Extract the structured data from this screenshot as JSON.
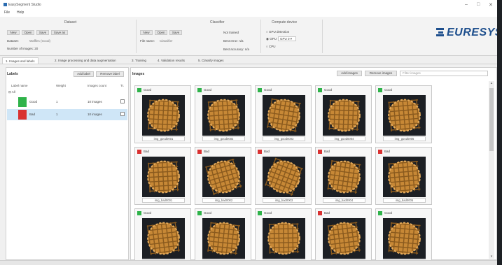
{
  "window": {
    "title": "EasySegment Studio",
    "controls": [
      "–",
      "□",
      "✕"
    ]
  },
  "menu": [
    "File",
    "Help"
  ],
  "ribbon": {
    "dataset": {
      "title": "Dataset",
      "buttons": [
        "New",
        "Open",
        "Save",
        "Save as"
      ],
      "project_label": "Dataset:",
      "project_value": "Waffles (Good)",
      "images_label": "Number of images: 20"
    },
    "classifier": {
      "title": "Classifier",
      "buttons": [
        "New",
        "Open",
        "Save"
      ],
      "name_label": "File name:",
      "name_value": "Classifier"
    },
    "stats": {
      "lines": [
        "Not trained",
        "Best error: n/a",
        "Best accuracy: n/a"
      ]
    },
    "compute": {
      "title": "Compute device",
      "auto_label": "GPU detection",
      "gpu_label": "GPU",
      "gpu_value": "GPU 0",
      "cpu_label": "CPU"
    }
  },
  "logo": {
    "text": "EURESYS",
    "color": "#1e4f8d",
    "icon": "euresys-logo-icon"
  },
  "tabs": [
    "1. Images and labels",
    "2. Image processing and data augmentation",
    "3. Training",
    "4. Validation results",
    "5. Classify images"
  ],
  "labels_panel": {
    "title": "Labels",
    "buttons": [
      "Add label",
      "Remove label"
    ],
    "columns": [
      "Label name",
      "Weight",
      "Images count",
      "Tr."
    ],
    "tree_root": "All",
    "rows": [
      {
        "name": "Good",
        "weight": "1",
        "images": "10 images",
        "color": "#2fb34a",
        "selected": false
      },
      {
        "name": "Bad",
        "weight": "1",
        "images": "10 images",
        "color": "#d93131",
        "selected": true
      }
    ]
  },
  "images_panel": {
    "title": "Images",
    "buttons": [
      "Add images",
      "Remove images"
    ],
    "search_placeholder": "Filter images",
    "cards": [
      {
        "label": "Good",
        "color": "#2fb34a",
        "file": "img_good0001"
      },
      {
        "label": "Good",
        "color": "#2fb34a",
        "file": "img_good0002"
      },
      {
        "label": "Good",
        "color": "#2fb34a",
        "file": "img_good0003"
      },
      {
        "label": "Good",
        "color": "#2fb34a",
        "file": "img_good0004"
      },
      {
        "label": "Good",
        "color": "#2fb34a",
        "file": "img_good0005"
      },
      {
        "label": "Bad",
        "color": "#d93131",
        "file": "img_bad0001"
      },
      {
        "label": "Bad",
        "color": "#d93131",
        "file": "img_bad0002"
      },
      {
        "label": "Bad",
        "color": "#d93131",
        "file": "img_bad0003"
      },
      {
        "label": "Bad",
        "color": "#d93131",
        "file": "img_bad0004"
      },
      {
        "label": "Bad",
        "color": "#d93131",
        "file": "img_bad0005"
      },
      {
        "label": "Good",
        "color": "#2fb34a",
        "file": "img_good0006"
      },
      {
        "label": "Good",
        "color": "#2fb34a",
        "file": "img_good0007"
      },
      {
        "label": "Good",
        "color": "#2fb34a",
        "file": "img_good0008"
      },
      {
        "label": "Bad",
        "color": "#d93131",
        "file": "img_bad0006"
      },
      {
        "label": "Good",
        "color": "#2fb34a",
        "file": "img_good0009"
      }
    ]
  }
}
